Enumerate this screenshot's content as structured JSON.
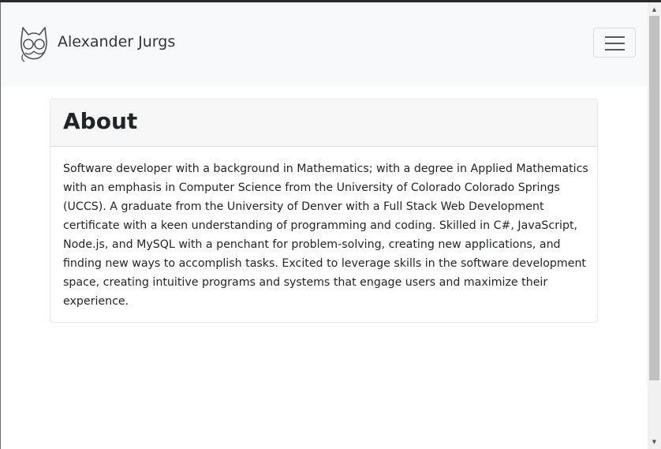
{
  "navbar": {
    "brand_name": "Alexander Jurgs",
    "logo_icon": "cat-glasses-logo-icon",
    "toggler_icon": "hamburger-menu-icon"
  },
  "about": {
    "title": "About",
    "text": "Software developer with a background in Mathematics; with a degree in Applied Mathematics with an emphasis in Computer Science from the University of Colorado Colorado Springs (UCCS). A graduate from the University of Denver with a Full Stack Web Development certificate with a keen understanding of programming and coding. Skilled in C#, JavaScript, Node.js, and MySQL with a penchant for problem-solving, creating new applications, and finding new ways to accomplish tasks. Excited to leverage skills in the software development space, creating intuitive programs and systems that engage users and maximize their experience."
  },
  "scrollbar": {
    "up_arrow": "▲",
    "down_arrow": "▼"
  },
  "colors": {
    "navbar_bg": "#f8f9fa",
    "card_header_bg": "#f7f7f7",
    "text": "#212529"
  }
}
